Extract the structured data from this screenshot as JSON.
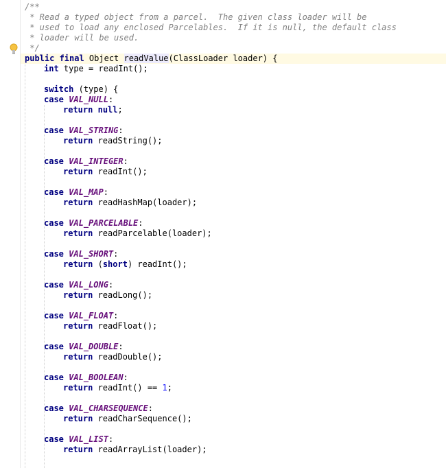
{
  "doc_comment": {
    "open": "/**",
    "line1": " * Read a typed object from a parcel.  The given class loader will be",
    "line2": " * used to load any enclosed Parcelables.  If it is null, the default class",
    "line3": " * loader will be used.",
    "close": " */"
  },
  "signature": {
    "modifiers": "public final",
    "return_type": " Object ",
    "method_name": "readValue",
    "params": "(ClassLoader loader) {"
  },
  "decl": {
    "type_kw": "int",
    "rest": " type = readInt();"
  },
  "switch_line": {
    "kw": "switch",
    "rest": " (type) {"
  },
  "cases": [
    {
      "kw": "case",
      "const": "VAL_NULL",
      "ret_kw": "return",
      "ret_lit_kw": "null",
      "ret_rest": ";"
    },
    {
      "kw": "case",
      "const": "VAL_STRING",
      "ret_kw": "return",
      "ret_rest": " readString();"
    },
    {
      "kw": "case",
      "const": "VAL_INTEGER",
      "ret_kw": "return",
      "ret_rest": " readInt();"
    },
    {
      "kw": "case",
      "const": "VAL_MAP",
      "ret_kw": "return",
      "ret_rest": " readHashMap(loader);"
    },
    {
      "kw": "case",
      "const": "VAL_PARCELABLE",
      "ret_kw": "return",
      "ret_rest": " readParcelable(loader);"
    },
    {
      "kw": "case",
      "const": "VAL_SHORT",
      "ret_kw": "return",
      "ret_pre": " (",
      "ret_cast_kw": "short",
      "ret_rest": ") readInt();"
    },
    {
      "kw": "case",
      "const": "VAL_LONG",
      "ret_kw": "return",
      "ret_rest": " readLong();"
    },
    {
      "kw": "case",
      "const": "VAL_FLOAT",
      "ret_kw": "return",
      "ret_rest": " readFloat();"
    },
    {
      "kw": "case",
      "const": "VAL_DOUBLE",
      "ret_kw": "return",
      "ret_rest": " readDouble();"
    },
    {
      "kw": "case",
      "const": "VAL_BOOLEAN",
      "ret_kw": "return",
      "ret_rest": " readInt() == ",
      "ret_num": "1",
      "ret_end": ";"
    },
    {
      "kw": "case",
      "const": "VAL_CHARSEQUENCE",
      "ret_kw": "return",
      "ret_rest": " readCharSequence();"
    },
    {
      "kw": "case",
      "const": "VAL_LIST",
      "ret_kw": "return",
      "ret_rest": " readArrayList(loader);"
    }
  ],
  "colors": {
    "keyword": "#000080",
    "comment": "#808080",
    "constant": "#660e7a",
    "number": "#0000ff",
    "current_line": "#fffae3",
    "identifier_highlight": "#edebfc"
  },
  "icons": {
    "gutter_intention": "lightbulb-icon"
  }
}
